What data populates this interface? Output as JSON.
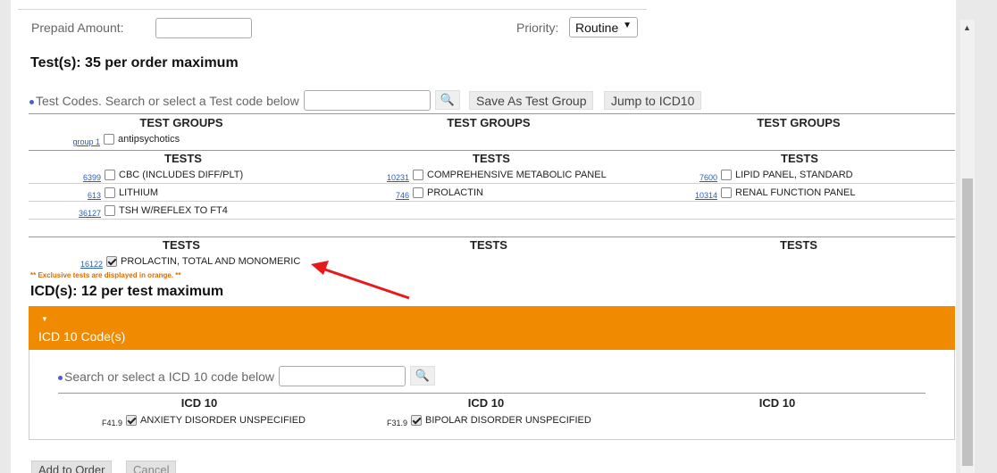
{
  "form": {
    "prepaid_label": "Prepaid Amount:",
    "prepaid_value": "",
    "priority_label": "Priority:",
    "priority_value": "Routine"
  },
  "tests_section": {
    "heading": "Test(s): 35 per order maximum",
    "search_label": "Test Codes. Search or select a Test code below",
    "search_value": "",
    "save_group_button": "Save As Test Group",
    "jump_button": "Jump to ICD10",
    "groups_headers": [
      "TEST GROUPS",
      "TEST GROUPS",
      "TEST GROUPS"
    ],
    "group_item": {
      "code": "group 1",
      "label": "antipsychotics",
      "checked": false
    },
    "tests_headers": [
      "TESTS",
      "TESTS",
      "TESTS"
    ],
    "tests": [
      {
        "code": "6399",
        "label": "CBC (INCLUDES DIFF/PLT)",
        "checked": false
      },
      {
        "code": "10231",
        "label": "COMPREHENSIVE METABOLIC PANEL",
        "checked": false
      },
      {
        "code": "7600",
        "label": "LIPID PANEL, STANDARD",
        "checked": false
      },
      {
        "code": "613",
        "label": "LITHIUM",
        "checked": false
      },
      {
        "code": "746",
        "label": "PROLACTIN",
        "checked": false
      },
      {
        "code": "10314",
        "label": "RENAL FUNCTION PANEL",
        "checked": false
      },
      {
        "code": "36127",
        "label": "TSH W/REFLEX TO FT4",
        "checked": false
      }
    ],
    "selected_headers": [
      "TESTS",
      "TESTS",
      "TESTS"
    ],
    "selected_tests": [
      {
        "code": "16122",
        "label": "PROLACTIN, TOTAL AND MONOMERIC",
        "checked": true
      }
    ],
    "exclusive_note": "** Exclusive tests are displayed in orange. **"
  },
  "icd_section": {
    "heading": "ICD(s): 12 per test maximum",
    "bar_title": "ICD 10 Code(s)",
    "search_label": "Search or select a ICD 10 code below",
    "search_value": "",
    "headers": [
      "ICD 10",
      "ICD 10",
      "ICD 10"
    ],
    "codes": [
      {
        "code": "F41.9",
        "label": "ANXIETY DISORDER UNSPECIFIED",
        "checked": true
      },
      {
        "code": "F31.9",
        "label": "BIPOLAR DISORDER UNSPECIFIED",
        "checked": true
      }
    ]
  },
  "footer": {
    "add_button": "Add to Order",
    "cancel_button": "Cancel"
  },
  "colors": {
    "accent_orange": "#f08a00",
    "annotation_arrow": "#e8191b",
    "link_blue": "#2a5db0"
  },
  "icons": {
    "search": "binoculars-icon",
    "dropdown": "triangle-down-icon"
  }
}
